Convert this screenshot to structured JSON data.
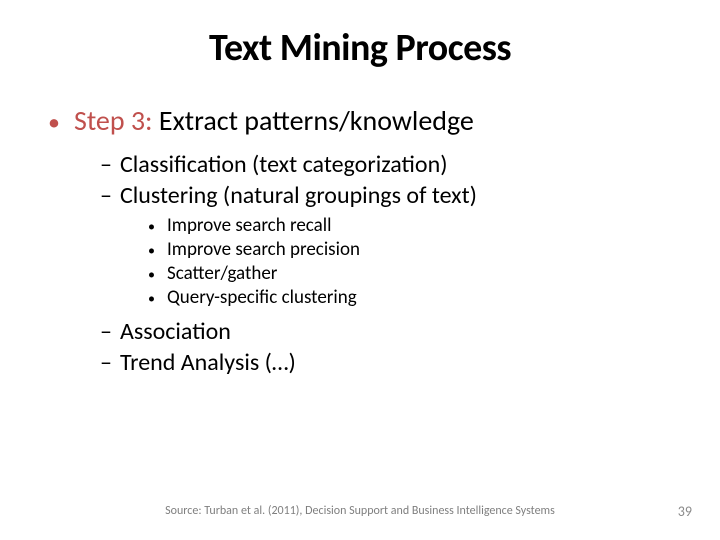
{
  "title": "Text Mining Process",
  "main": {
    "step_label": "Step 3:",
    "step_text": " Extract patterns/knowledge"
  },
  "subs": {
    "s1": "Classification (text categorization)",
    "s2": "Clustering (natural groupings of text)",
    "s3": "Association",
    "s4": "Trend Analysis (…)"
  },
  "inner": {
    "i1": "Improve search recall",
    "i2": "Improve search precision",
    "i3": "Scatter/gather",
    "i4": "Query-specific clustering"
  },
  "footer": "Source:  Turban et al. (2011), Decision Support and Business Intelligence Systems",
  "page_number": "39"
}
